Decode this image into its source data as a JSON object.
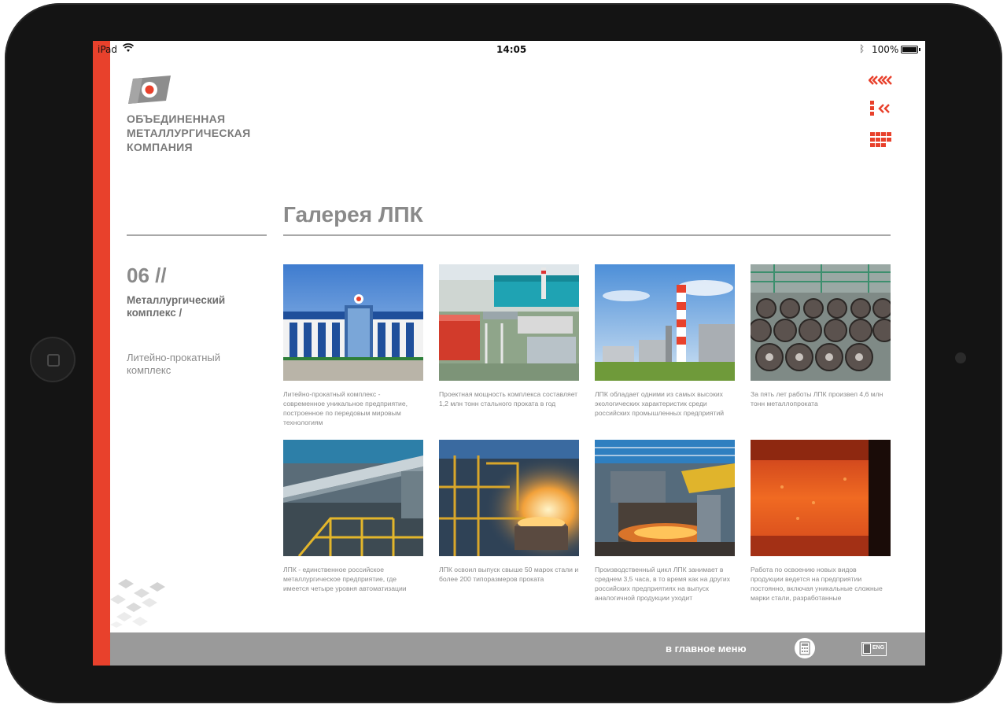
{
  "status_bar": {
    "carrier": "iPad",
    "time": "14:05",
    "battery": "100%"
  },
  "brand": {
    "line1": "ОБЪЕДИНЕННАЯ",
    "line2": "МЕТАЛЛУРГИЧЕСКАЯ",
    "line3": "КОМПАНИЯ",
    "accent_color": "#e8412c",
    "text_color": "#7a7a7a"
  },
  "nav_icons": [
    "back-icon",
    "list-back-icon",
    "grid-menu-icon"
  ],
  "page": {
    "title": "Галерея ЛПК"
  },
  "sidebar": {
    "number": "06 //",
    "section": "Металлургический комплекс /",
    "subsection": "Литейно-прокатный комплекс"
  },
  "gallery": [
    {
      "caption": "Литейно-прокатный комплекс - современное уникальное предприятие, построенное по передовым мировым технологиям",
      "icon": "admin-building-photo"
    },
    {
      "caption": "Проектная мощность комплекса составляет 1,2 млн тонн стального проката в год",
      "icon": "plant-aerial-photo"
    },
    {
      "caption": "ЛПК обладает одними из самых высоких экологических характеристик среди российских промышленных предприятий",
      "icon": "chimney-photo"
    },
    {
      "caption": "За пять лет работы ЛПК произвел 4,6 млн тонн металлопроката",
      "icon": "steel-coils-photo"
    },
    {
      "caption": "ЛПК - единственное российское металлургическое предприятие, где имеется четыре уровня автоматизации",
      "icon": "rolling-mill-photo"
    },
    {
      "caption": "ЛПК освоил выпуск свыше 50 марок стали и более 200 типоразмеров проката",
      "icon": "furnace-photo"
    },
    {
      "caption": "Производственный цикл ЛПК занимает в среднем 3,5 часа, в то время как на других российских предприятиях на выпуск аналогичной продукции уходит",
      "icon": "workshop-photo"
    },
    {
      "caption": "Работа по освоению новых видов продукции ведется на предприятии постоянно, включая уникальные сложные марки стали, разработанные",
      "icon": "hot-slab-photo"
    }
  ],
  "footer": {
    "main_menu": "в главное меню",
    "lang": "ENG"
  }
}
